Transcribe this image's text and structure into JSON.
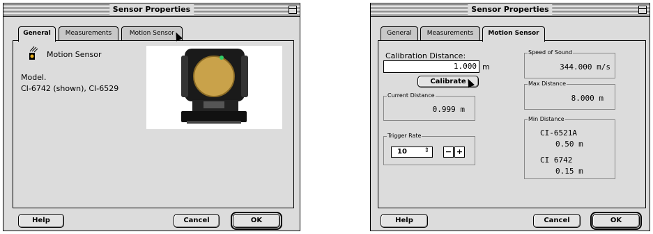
{
  "left_window": {
    "title": "Sensor Properties",
    "tabs": [
      "General",
      "Measurements",
      "Motion Sensor"
    ],
    "active_tab": "General",
    "sensor_name": "Motion Sensor",
    "model_label": "Model.",
    "model_value": "CI-6742 (shown), CI-6529",
    "buttons": {
      "help": "Help",
      "cancel": "Cancel",
      "ok": "OK"
    }
  },
  "right_window": {
    "title": "Sensor Properties",
    "tabs": [
      "General",
      "Measurements",
      "Motion Sensor"
    ],
    "active_tab": "Motion Sensor",
    "calibration": {
      "label": "Calibration Distance:",
      "value": "1.000",
      "unit": "m",
      "button": "Calibrate"
    },
    "current_distance": {
      "label": "Current Distance",
      "value": "0.999 m"
    },
    "trigger_rate": {
      "label": "Trigger Rate",
      "value": "10",
      "minus": "−",
      "plus": "+"
    },
    "speed_of_sound": {
      "label": "Speed of Sound",
      "value": "344.000 m/s"
    },
    "max_distance": {
      "label": "Max Distance",
      "value": "8.000 m"
    },
    "min_distance": {
      "label": "Min Distance",
      "model1": "CI-6521A",
      "value1": "0.50 m",
      "model2": "CI 6742",
      "value2": "0.15 m"
    },
    "buttons": {
      "help": "Help",
      "cancel": "Cancel",
      "ok": "OK"
    }
  },
  "colors": {
    "window_bg": "#dcdcdc",
    "border": "#000000",
    "speaker_grille": "#c9a24a"
  }
}
